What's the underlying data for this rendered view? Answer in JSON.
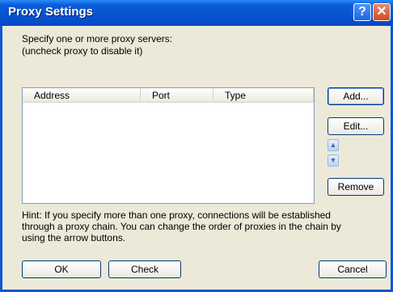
{
  "window": {
    "title": "Proxy Settings",
    "help_glyph": "?",
    "close_glyph": "✕"
  },
  "description": {
    "line1": "Specify one or more proxy servers:",
    "line2": "(uncheck proxy to disable it)"
  },
  "list": {
    "columns": [
      "Address",
      "Port",
      "Type"
    ],
    "rows": []
  },
  "side_buttons": {
    "add": "Add...",
    "edit": "Edit...",
    "up_glyph": "▲",
    "down_glyph": "▼",
    "remove": "Remove"
  },
  "hint": {
    "line1": "Hint: If you specify more than one proxy, connections will be established",
    "line2": "through a proxy chain. You can change the order of proxies in the chain by",
    "line3": "using the arrow buttons."
  },
  "footer": {
    "ok": "OK",
    "check": "Check",
    "cancel": "Cancel"
  }
}
